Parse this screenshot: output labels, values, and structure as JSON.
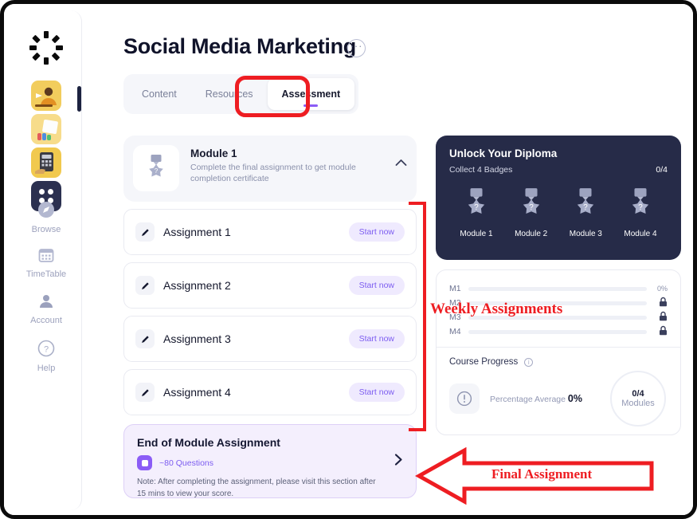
{
  "sidebar": {
    "logo_icon": "canvas-ring-logo",
    "thumbnails": [
      {
        "name": "course-thumb-1",
        "icon": "course-thumbnail-presenter"
      },
      {
        "name": "course-thumb-2",
        "icon": "course-thumbnail-notebook"
      },
      {
        "name": "course-thumb-3",
        "icon": "course-thumbnail-calculator"
      }
    ],
    "grid_icon": "apps-grid-icon",
    "items": [
      {
        "label": "Browse",
        "icon": "compass-icon"
      },
      {
        "label": "TimeTable",
        "icon": "calendar-icon"
      },
      {
        "label": "Account",
        "icon": "person-icon"
      },
      {
        "label": "Help",
        "icon": "question-circle-icon"
      }
    ]
  },
  "header": {
    "title": "Social Media Marketing",
    "more_icon": "ellipsis-icon",
    "more_label": "···"
  },
  "tabs": [
    {
      "label": "Content",
      "active": false
    },
    {
      "label": "Resources",
      "active": false
    },
    {
      "label": "Assessment",
      "active": true
    }
  ],
  "module": {
    "badge_icon": "locked-medal-badge-icon",
    "name": "Module 1",
    "description": "Complete the final assignment to get module completion certificate",
    "collapse_icon": "chevron-up-icon"
  },
  "assignments": [
    {
      "icon": "pencil-icon",
      "name": "Assignment 1",
      "action": "Start now"
    },
    {
      "icon": "pencil-icon",
      "name": "Assignment 2",
      "action": "Start now"
    },
    {
      "icon": "pencil-icon",
      "name": "Assignment 3",
      "action": "Start now"
    },
    {
      "icon": "pencil-icon",
      "name": "Assignment 4",
      "action": "Start now"
    }
  ],
  "end_of_module": {
    "title": "End of Module Assignment",
    "questions_icon": "folder-icon",
    "questions": "~80 Questions",
    "note": "Note: After completing the assignment, please visit this section after 15 mins to view your score.",
    "arrow_icon": "chevron-right-icon"
  },
  "diploma": {
    "title": "Unlock Your Diploma",
    "subtitle": "Collect 4 Badges",
    "count": "0/4",
    "badges": [
      {
        "label": "Module 1",
        "icon": "locked-medal-badge-icon"
      },
      {
        "label": "Module 2",
        "icon": "locked-medal-badge-icon"
      },
      {
        "label": "Module 3",
        "icon": "locked-medal-badge-icon"
      },
      {
        "label": "Module 4",
        "icon": "locked-medal-badge-icon"
      }
    ]
  },
  "module_progress": {
    "rows": [
      {
        "label": "M1",
        "percent": 0,
        "right": "0%",
        "locked": false
      },
      {
        "label": "M2",
        "percent": 0,
        "right": "lock-icon",
        "locked": true
      },
      {
        "label": "M3",
        "percent": 0,
        "right": "lock-icon",
        "locked": true
      },
      {
        "label": "M4",
        "percent": 0,
        "right": "lock-icon",
        "locked": true
      }
    ],
    "lock_glyph": "🔒"
  },
  "course_progress": {
    "title": "Course Progress",
    "info_icon": "info-icon",
    "alert_icon": "alert-circle-icon",
    "average_label": "Percentage Average",
    "average_value": "0%",
    "donut_value": "0/4",
    "donut_unit": "Modules"
  },
  "annotations": {
    "weekly": "Weekly Assignments",
    "final": "Final Assignment",
    "color": "#ee1d22"
  },
  "colors": {
    "accent_purple": "#8b5cf6",
    "pill_bg": "#efeafe",
    "dark_card": "#262b48",
    "annotation_red": "#ee1d22"
  }
}
